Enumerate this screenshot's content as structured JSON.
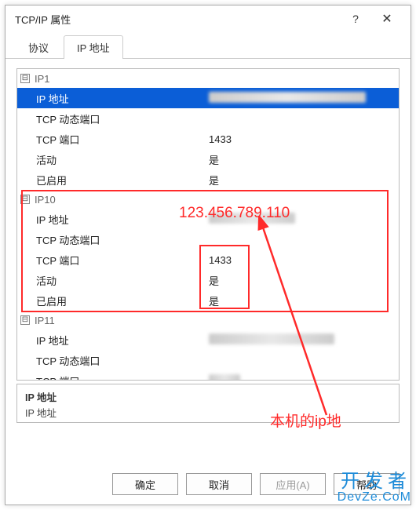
{
  "title": "TCP/IP 属性",
  "tabs": {
    "protocol": "协议",
    "ip_address": "IP 地址"
  },
  "buttons": {
    "ok": "确定",
    "cancel": "取消",
    "apply": "应用(A)",
    "help": "帮助"
  },
  "dialog_icons": {
    "help": "?",
    "close": "✕"
  },
  "collapse_icon": "⊟",
  "labels": {
    "ip_addr": "IP 地址",
    "tcp_dyn_port": "TCP 动态端口",
    "tcp_port": "TCP 端口",
    "active": "活动",
    "enabled": "已启用"
  },
  "sections": [
    {
      "name": "IP1",
      "rows": {
        "ip": "",
        "dyn": "",
        "port": "1433",
        "active": "是",
        "enabled": "是"
      }
    },
    {
      "name": "IP10",
      "rows": {
        "ip": "",
        "dyn": "",
        "port": "1433",
        "active": "是",
        "enabled": "是"
      }
    },
    {
      "name": "IP11",
      "rows": {
        "ip": "",
        "dyn": "",
        "port": ""
      }
    }
  ],
  "desc": {
    "title": "IP 地址",
    "text": "IP 地址"
  },
  "annotations": {
    "ip_value": "123.456.789.110",
    "note": "本机的ip地"
  },
  "watermark": {
    "line1": "开发者",
    "line2": "DevZe.CoM"
  }
}
